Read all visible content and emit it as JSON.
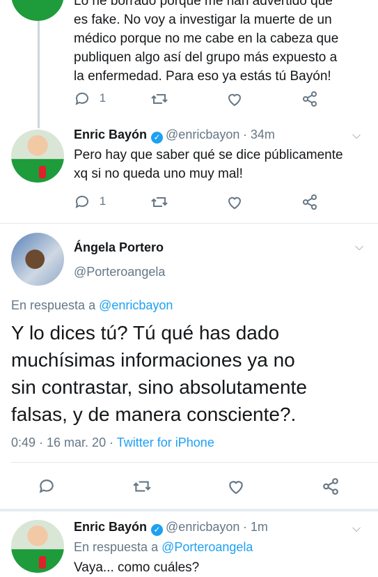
{
  "tweet1": {
    "lines": [
      "Lo he borrado porque me han advertido que",
      "es fake. No voy a investigar la muerte de un",
      "médico porque no me cabe en la cabeza que",
      "publiquen algo así del grupo más expuesto a",
      "la enfermedad. Para eso ya estás tú Bayón!"
    ],
    "reply_count": "1"
  },
  "tweet2": {
    "name": "Enric Bayón",
    "handle": "@enricbayon",
    "time": "· 34m",
    "lines": [
      "Pero hay que saber qué se dice públicamente",
      "xq si no queda uno muy mal!"
    ],
    "reply_count": "1"
  },
  "main_tweet": {
    "name": "Ángela Portero",
    "handle": "@Porteroangela",
    "reply_prefix": "En respuesta a ",
    "reply_to": "@enricbayon",
    "lines": [
      "Y lo dices tú? Tú qué has dado",
      "muchísimas informaciones ya no",
      "sin contrastar,  sino absolutamente",
      "falsas, y de manera consciente?."
    ],
    "timestamp": "0:49 · 16 mar. 20 · ",
    "source": "Twitter for iPhone"
  },
  "tweet4": {
    "name": "Enric Bayón",
    "handle": "@enricbayon",
    "time": "· 1m",
    "reply_prefix": "En respuesta a ",
    "reply_to": "@Porteroangela",
    "partial_line": "Vaya... como cuáles?"
  },
  "colors": {
    "accent": "#1da1f2",
    "muted": "#657786",
    "text": "#14171a"
  },
  "icons": [
    "reply-icon",
    "retweet-icon",
    "like-icon",
    "share-icon",
    "chevron-down-icon",
    "verified-icon"
  ]
}
